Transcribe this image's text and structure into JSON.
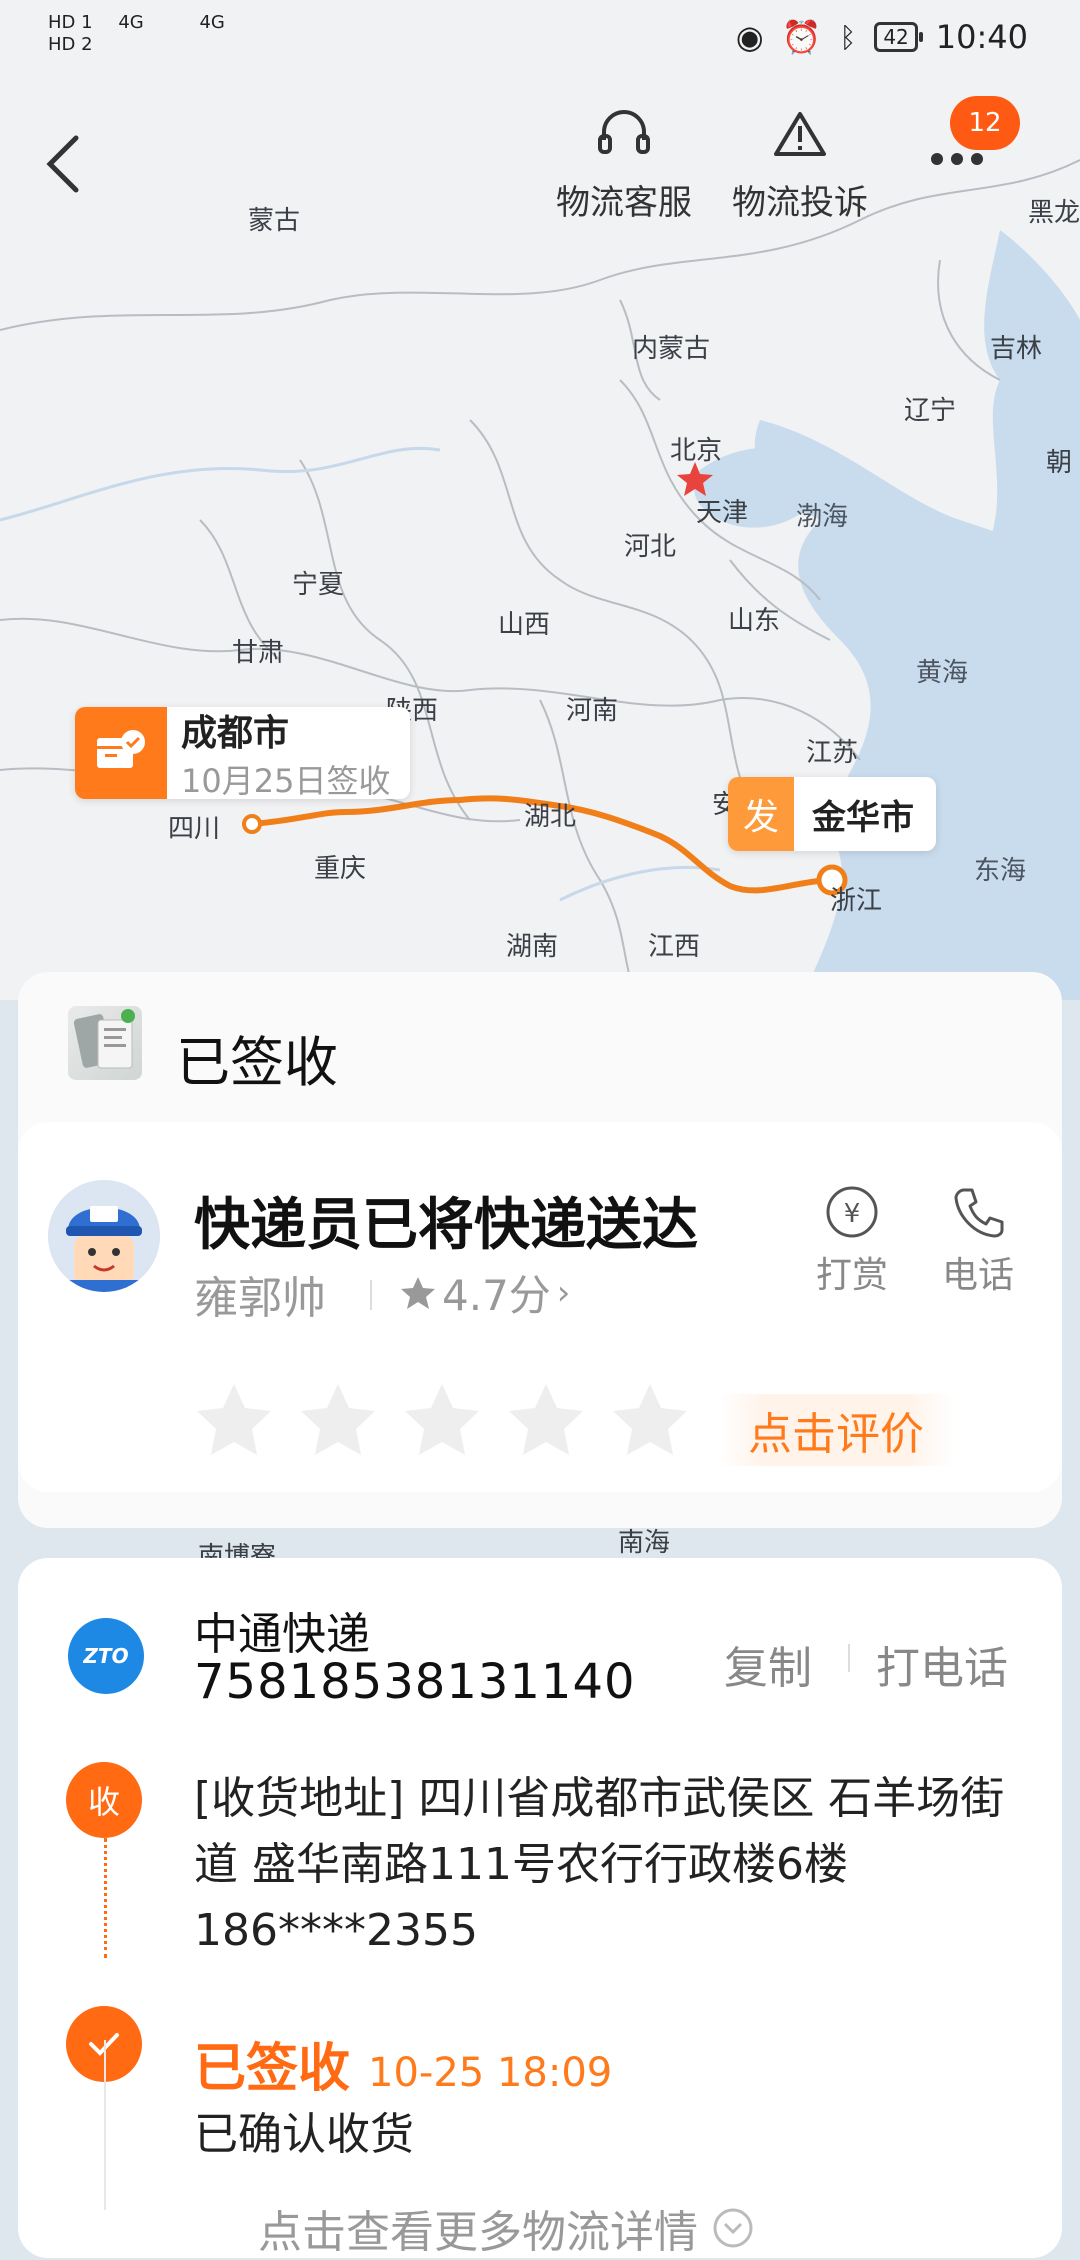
{
  "status_bar": {
    "sim1": "HD 1",
    "sim2": "HD 2",
    "net1": "4G",
    "net2": "4G",
    "battery": "42",
    "time": "10:40"
  },
  "header": {
    "service_label": "物流客服",
    "complaint_label": "物流投诉",
    "notification_count": "12"
  },
  "map": {
    "places": [
      "蒙古",
      "黑龙",
      "内蒙古",
      "吉林",
      "辽宁",
      "北京",
      "天津",
      "朝",
      "渤海",
      "河北",
      "宁夏",
      "山西",
      "山东",
      "甘肃",
      "黄海",
      "陕西",
      "河南",
      "江苏",
      "湖北",
      "安",
      "四川",
      "重庆",
      "东海",
      "浙江",
      "湖南",
      "江西"
    ],
    "origin": {
      "city": "成都市",
      "status": "10月25日签收"
    },
    "destination": {
      "badge": "发",
      "city": "金华市"
    },
    "route_color": "#f07f1a"
  },
  "status_panel": {
    "title": "已签收",
    "courier": {
      "headline": "快递员已将快递送达",
      "name": "雍郭帅",
      "rating": "4.7分",
      "tip_label": "打赏",
      "phone_label": "电话",
      "rate_button": "点击评价"
    }
  },
  "map_below": [
    "南博寮",
    "南海"
  ],
  "detail_panel": {
    "carrier": "中通快递",
    "tracking_no": "75818538131140",
    "copy_label": "复制",
    "call_label": "打电话",
    "logo_text": "ZTO",
    "recv_badge": "收",
    "address": "[收货地址] 四川省成都市武侯区 石羊场街道   盛华南路111号农行行政楼6楼 186****2355",
    "signed_title": "已签收",
    "signed_time": "10-25 18:09",
    "signed_desc": "已确认收货",
    "more_link": "点击查看更多物流详情"
  },
  "colors": {
    "accent": "#ff6a13",
    "carrier_blue": "#1e88e5"
  }
}
